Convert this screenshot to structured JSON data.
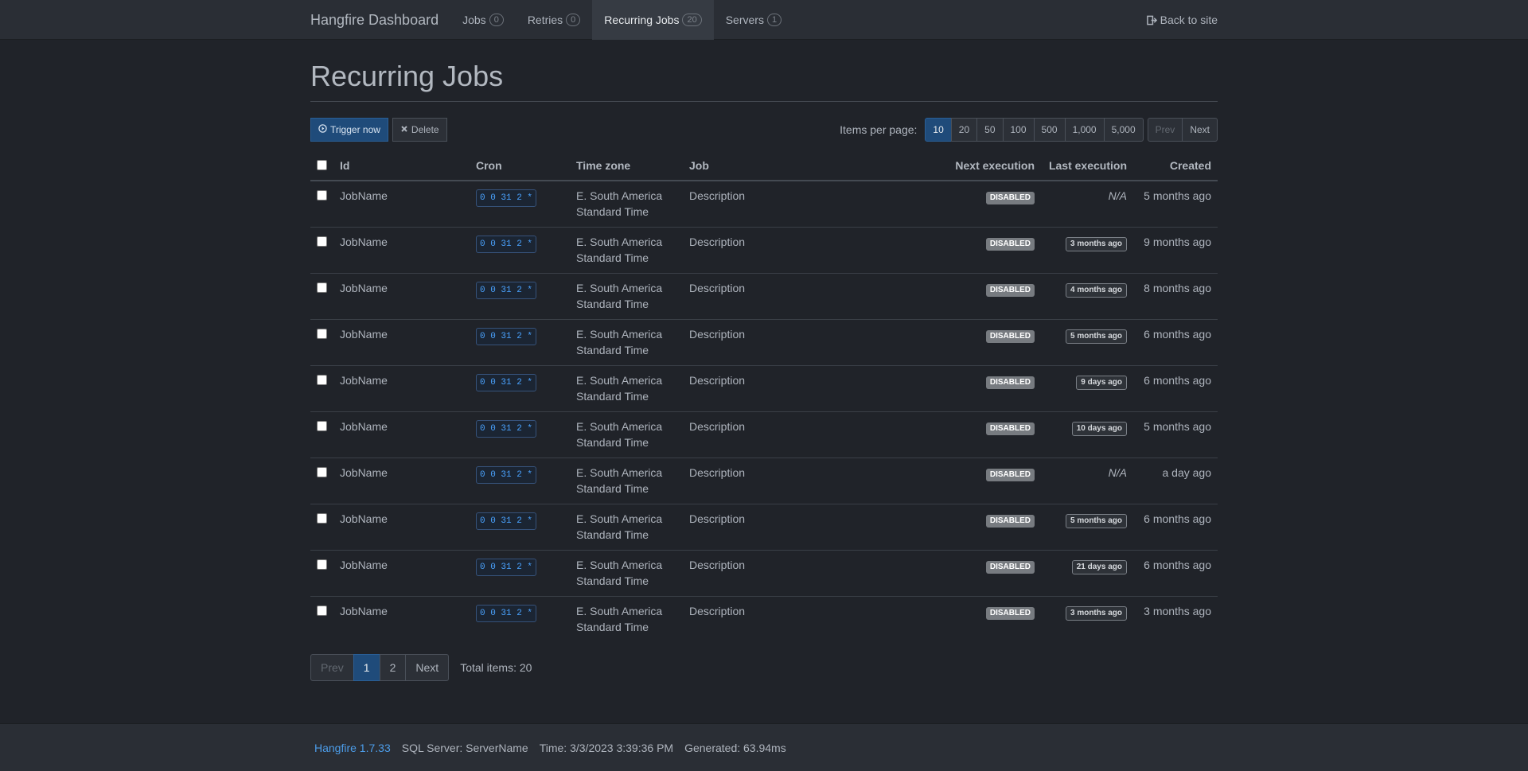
{
  "nav": {
    "brand": "Hangfire Dashboard",
    "items": [
      {
        "label": "Jobs",
        "count": "0"
      },
      {
        "label": "Retries",
        "count": "0"
      },
      {
        "label": "Recurring Jobs",
        "count": "20"
      },
      {
        "label": "Servers",
        "count": "1"
      }
    ],
    "back": "Back to site"
  },
  "page": {
    "title": "Recurring Jobs"
  },
  "toolbar": {
    "trigger": "Trigger now",
    "delete": "Delete",
    "ipp_label": "Items per page:",
    "ipp": [
      "10",
      "20",
      "50",
      "100",
      "500",
      "1,000",
      "5,000"
    ],
    "prev": "Prev",
    "next": "Next"
  },
  "table": {
    "headers": {
      "id": "Id",
      "cron": "Cron",
      "tz": "Time zone",
      "job": "Job",
      "next": "Next execution",
      "last": "Last execution",
      "created": "Created"
    },
    "rows": [
      {
        "id": "JobName",
        "cron": "0 0 31 2 *",
        "tz1": "E. South America",
        "tz2": "Standard Time",
        "job": "Description",
        "next": "DISABLED",
        "last": "N/A",
        "last_na": true,
        "created": "5 months ago"
      },
      {
        "id": "JobName",
        "cron": "0 0 31 2 *",
        "tz1": "E. South America",
        "tz2": "Standard Time",
        "job": "Description",
        "next": "DISABLED",
        "last": "3 months ago",
        "last_na": false,
        "created": "9 months ago"
      },
      {
        "id": "JobName",
        "cron": "0 0 31 2 *",
        "tz1": "E. South America",
        "tz2": "Standard Time",
        "job": "Description",
        "next": "DISABLED",
        "last": "4 months ago",
        "last_na": false,
        "created": "8 months ago"
      },
      {
        "id": "JobName",
        "cron": "0 0 31 2 *",
        "tz1": "E. South America",
        "tz2": "Standard Time",
        "job": "Description",
        "next": "DISABLED",
        "last": "5 months ago",
        "last_na": false,
        "created": "6 months ago"
      },
      {
        "id": "JobName",
        "cron": "0 0 31 2 *",
        "tz1": "E. South America",
        "tz2": "Standard Time",
        "job": "Description",
        "next": "DISABLED",
        "last": "9 days ago",
        "last_na": false,
        "created": "6 months ago"
      },
      {
        "id": "JobName",
        "cron": "0 0 31 2 *",
        "tz1": "E. South America",
        "tz2": "Standard Time",
        "job": "Description",
        "next": "DISABLED",
        "last": "10 days ago",
        "last_na": false,
        "created": "5 months ago"
      },
      {
        "id": "JobName",
        "cron": "0 0 31 2 *",
        "tz1": "E. South America",
        "tz2": "Standard Time",
        "job": "Description",
        "next": "DISABLED",
        "last": "N/A",
        "last_na": true,
        "created": "a day ago"
      },
      {
        "id": "JobName",
        "cron": "0 0 31 2 *",
        "tz1": "E. South America",
        "tz2": "Standard Time",
        "job": "Description",
        "next": "DISABLED",
        "last": "5 months ago",
        "last_na": false,
        "created": "6 months ago"
      },
      {
        "id": "JobName",
        "cron": "0 0 31 2 *",
        "tz1": "E. South America",
        "tz2": "Standard Time",
        "job": "Description",
        "next": "DISABLED",
        "last": "21 days ago",
        "last_na": false,
        "created": "6 months ago"
      },
      {
        "id": "JobName",
        "cron": "0 0 31 2 *",
        "tz1": "E. South America",
        "tz2": "Standard Time",
        "job": "Description",
        "next": "DISABLED",
        "last": "3 months ago",
        "last_na": false,
        "created": "3 months ago"
      }
    ]
  },
  "pager": {
    "prev": "Prev",
    "pages": [
      "1",
      "2"
    ],
    "next": "Next",
    "total": "Total items: 20"
  },
  "footer": {
    "version": "Hangfire 1.7.33",
    "server": "SQL Server: ServerName",
    "time": "Time: 3/3/2023 3:39:36 PM",
    "generated": "Generated: 63.94ms"
  },
  "colors": {
    "background": "#202329",
    "navbar": "#2a2e35",
    "accent": "#1f4b7a",
    "link": "#4c9ce8",
    "cron": "#4aa3ff"
  }
}
